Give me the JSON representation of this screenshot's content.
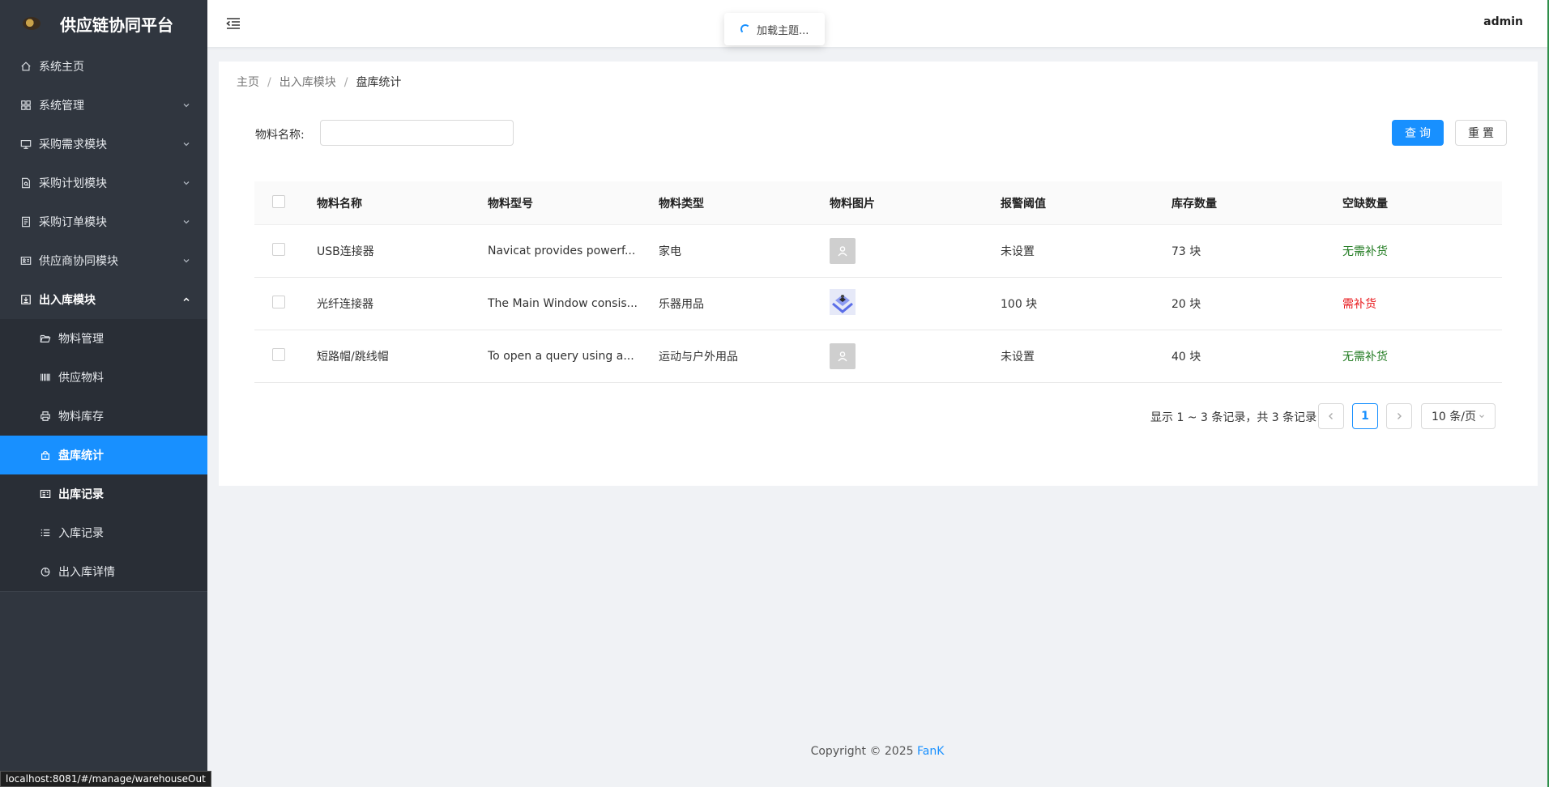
{
  "app": {
    "title": "供应链协同平台"
  },
  "header": {
    "user": "admin"
  },
  "toast": {
    "text": "加载主题..."
  },
  "sidebar": {
    "items": [
      {
        "label": "系统主页"
      },
      {
        "label": "系统管理"
      },
      {
        "label": "采购需求模块"
      },
      {
        "label": "采购计划模块"
      },
      {
        "label": "采购订单模块"
      },
      {
        "label": "供应商协同模块"
      },
      {
        "label": "出入库模块"
      }
    ],
    "sub": [
      {
        "label": "物料管理"
      },
      {
        "label": "供应物料"
      },
      {
        "label": "物料库存"
      },
      {
        "label": "盘库统计"
      },
      {
        "label": "出库记录"
      },
      {
        "label": "入库记录"
      },
      {
        "label": "出入库详情"
      }
    ]
  },
  "breadcrumb": {
    "home": "主页",
    "module": "出入库模块",
    "current": "盘库统计",
    "sep": "/"
  },
  "filter": {
    "label": "物料名称:",
    "value": "",
    "placeholder": ""
  },
  "buttons": {
    "query": "查询",
    "reset": "重置"
  },
  "table": {
    "columns": [
      "物料名称",
      "物料型号",
      "物料类型",
      "物料图片",
      "报警阈值",
      "库存数量",
      "空缺数量"
    ],
    "rows": [
      {
        "name": "USB连接器",
        "model": "Navicat provides powerf...",
        "type": "家电",
        "image": "avatar-placeholder",
        "threshold": "未设置",
        "stock": "73 块",
        "shortage": "无需补货",
        "status": "ok"
      },
      {
        "name": "光纤连接器",
        "model": "The Main Window consis...",
        "type": "乐器用品",
        "image": "product-image",
        "threshold": "100 块",
        "stock": "20 块",
        "shortage": "需补货",
        "status": "need"
      },
      {
        "name": "短路帽/跳线帽",
        "model": "To open a query using a...",
        "type": "运动与户外用品",
        "image": "avatar-placeholder",
        "threshold": "未设置",
        "stock": "40 块",
        "shortage": "无需补货",
        "status": "ok"
      }
    ]
  },
  "pagination": {
    "total_text": "显示 1 ~ 3 条记录，共 3 条记录",
    "current_page": "1",
    "page_size": "10 条/页"
  },
  "footer": {
    "copyright": "Copyright © 2025",
    "brand": "FanK"
  },
  "status_bar": {
    "url": "localhost:8081/#/manage/warehouseOut"
  },
  "colors": {
    "primary": "#1890ff",
    "sidebar_bg": "#30363f",
    "ok": "#1f7a1f",
    "need": "#e8191c"
  }
}
